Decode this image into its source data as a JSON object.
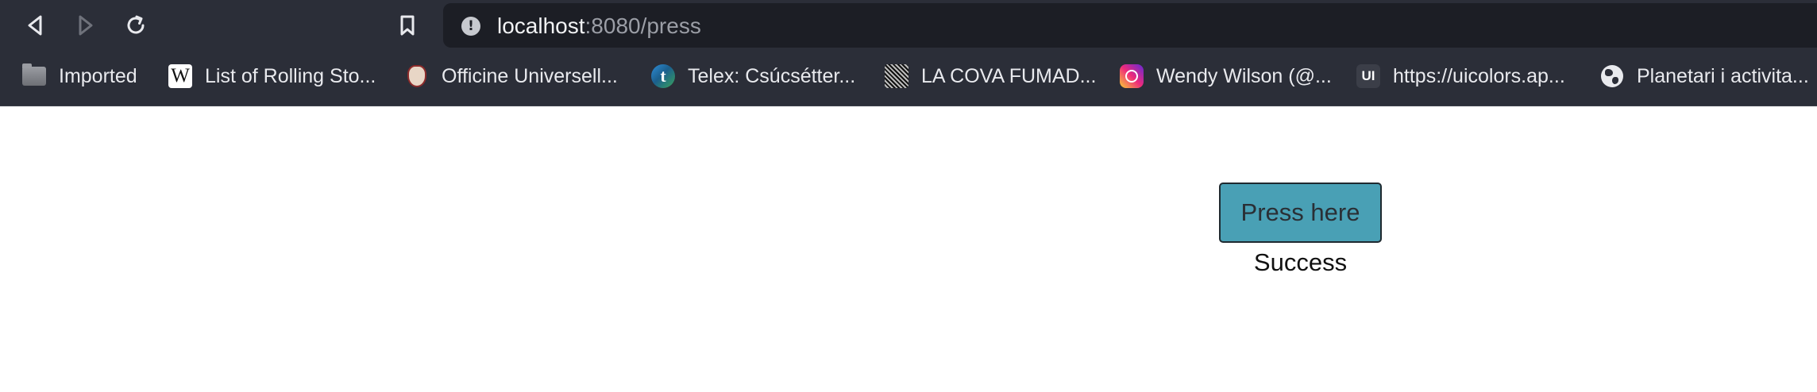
{
  "browser": {
    "url": {
      "host": "localhost",
      "rest": ":8080/press"
    },
    "nav_icons": {
      "back": "back-arrow-icon",
      "forward": "forward-arrow-icon",
      "reload": "reload-icon",
      "bookmark": "bookmark-icon",
      "site_info": "site-info-icon"
    },
    "bookmarks": [
      {
        "label": "Imported",
        "icon": "folder-icon"
      },
      {
        "label": "List of Rolling Sto...",
        "icon": "wikipedia-icon"
      },
      {
        "label": "Officine Universell...",
        "icon": "crest-icon"
      },
      {
        "label": "Telex: Csúcsétter...",
        "icon": "telex-icon"
      },
      {
        "label": "LA COVA FUMAD...",
        "icon": "pattern-icon"
      },
      {
        "label": "Wendy Wilson (@...",
        "icon": "instagram-icon"
      },
      {
        "label": "https://uicolors.ap...",
        "icon": "ui-icon"
      },
      {
        "label": "Planetari i activita...",
        "icon": "globe-icon"
      }
    ],
    "icon_glyphs": {
      "wiki": "W",
      "telex": "t",
      "ui": "UI",
      "site_info": "!"
    }
  },
  "page": {
    "button_label": "Press here",
    "status": "Success"
  },
  "colors": {
    "chrome_bg": "#2b2e38",
    "urlbar_bg": "#1c1e25",
    "button_bg": "#49a0b5"
  }
}
